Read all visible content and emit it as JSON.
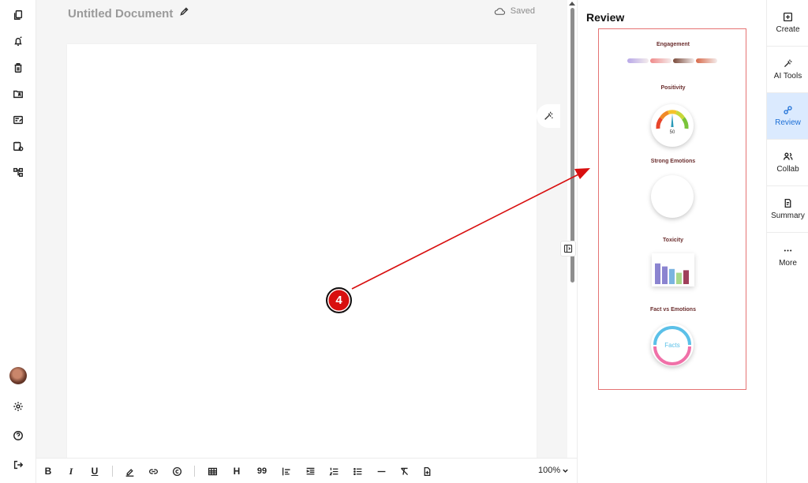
{
  "editor": {
    "title": "Untitled Document",
    "save_status": "Saved",
    "zoom": "100%"
  },
  "left_rail": {
    "icons": [
      "documents-icon",
      "notifications-icon",
      "trash-icon",
      "shared-folder-icon",
      "templates-icon",
      "schedule-icon",
      "workflow-icon",
      "avatar",
      "settings-icon",
      "help-icon",
      "logout-icon"
    ]
  },
  "toolbar": {
    "icons": [
      "bold-icon",
      "italic-icon",
      "underline-icon",
      "highlight-icon",
      "link-icon",
      "copyright-icon",
      "table-icon",
      "heading-icon",
      "quote-icon",
      "align-left-icon",
      "indent-icon",
      "numbered-list-icon",
      "bullet-list-icon",
      "horizontal-rule-icon",
      "clear-format-icon",
      "insert-file-icon"
    ],
    "bold": "B",
    "italic": "I",
    "underline": "U",
    "heading": "H",
    "quote": "99"
  },
  "review": {
    "title": "Review",
    "engagement_label": "Engagement",
    "positivity_label": "Positivity",
    "positivity_value": "50",
    "positivity_level": 0.5,
    "strong_emotions_label": "Strong Emotions",
    "toxicity_label": "Toxicity",
    "fact_label": "Fact vs Emotions",
    "fact_center": "Facts",
    "toxicity_bars": [
      0.82,
      0.7,
      0.6,
      0.45,
      0.55
    ],
    "colors": {
      "engagement": [
        "#b8a8e8",
        "#f08a8a",
        "#7a4a3a",
        "#d86a4a"
      ],
      "toxicity": [
        "#8b84d0",
        "#8b84d0",
        "#7bb4e0",
        "#a8d88a",
        "#a0405a"
      ],
      "facts": "#5bc0e8",
      "emotions": "#f070a8",
      "highlight_box": "#e57373"
    }
  },
  "right_rail": {
    "items": [
      {
        "label": "Create"
      },
      {
        "label": "AI Tools"
      },
      {
        "label": "Review"
      },
      {
        "label": "Collab"
      },
      {
        "label": "Summary"
      },
      {
        "label": "More"
      }
    ]
  },
  "annotation": {
    "step": "4",
    "color": "#d80f0f"
  }
}
